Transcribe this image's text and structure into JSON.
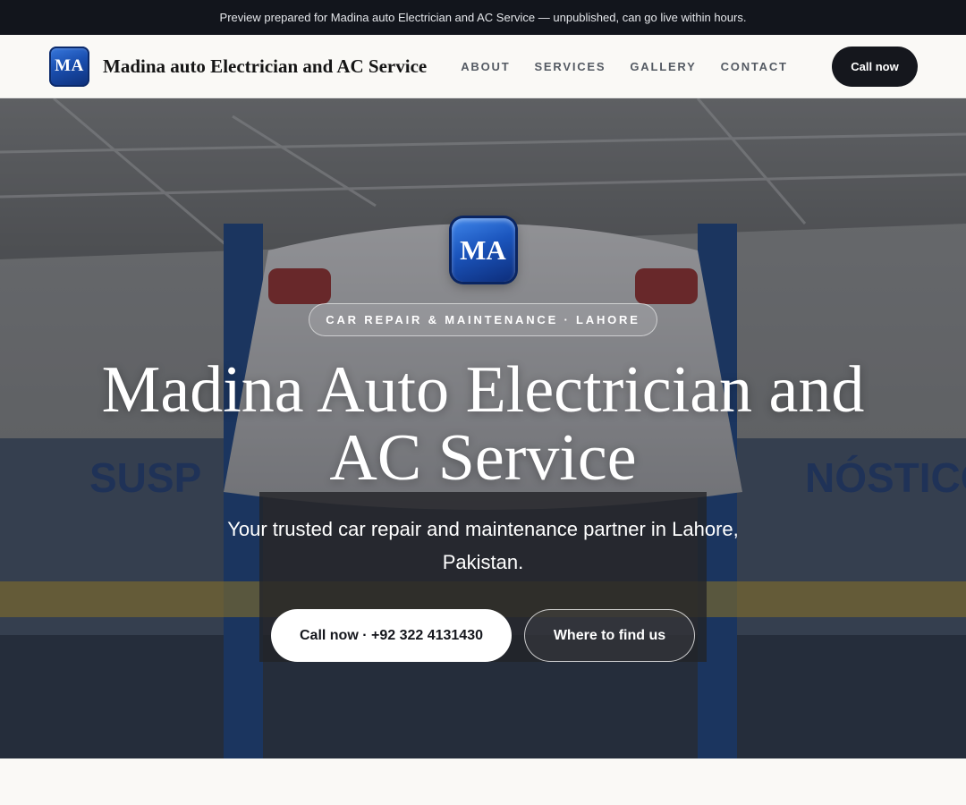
{
  "preview_bar": {
    "text": "Preview prepared for Madina auto Electrician and AC Service — unpublished, can go live within hours."
  },
  "header": {
    "logo_text": "MA",
    "brand_name": "Madina auto Electrician and AC Service",
    "nav": [
      {
        "label": "ABOUT"
      },
      {
        "label": "SERVICES"
      },
      {
        "label": "GALLERY"
      },
      {
        "label": "CONTACT"
      }
    ],
    "cta_label": "Call now"
  },
  "hero": {
    "logo_text": "MA",
    "tagline": "CAR REPAIR & MAINTENANCE · LAHORE",
    "title": "Madina Auto Electrician and AC Service",
    "subtitle": "Your trusted car repair and maintenance partner in Lahore, Pakistan.",
    "primary_button": "Call now · +92 322 4131430",
    "secondary_button": "Where to find us",
    "background_description_icon": "garage-photo"
  },
  "colors": {
    "preview_bar_bg": "#12151c",
    "nav_cta_bg": "#15171d",
    "logo_blue": "#1b55bd",
    "page_bg": "#faf9f6"
  }
}
